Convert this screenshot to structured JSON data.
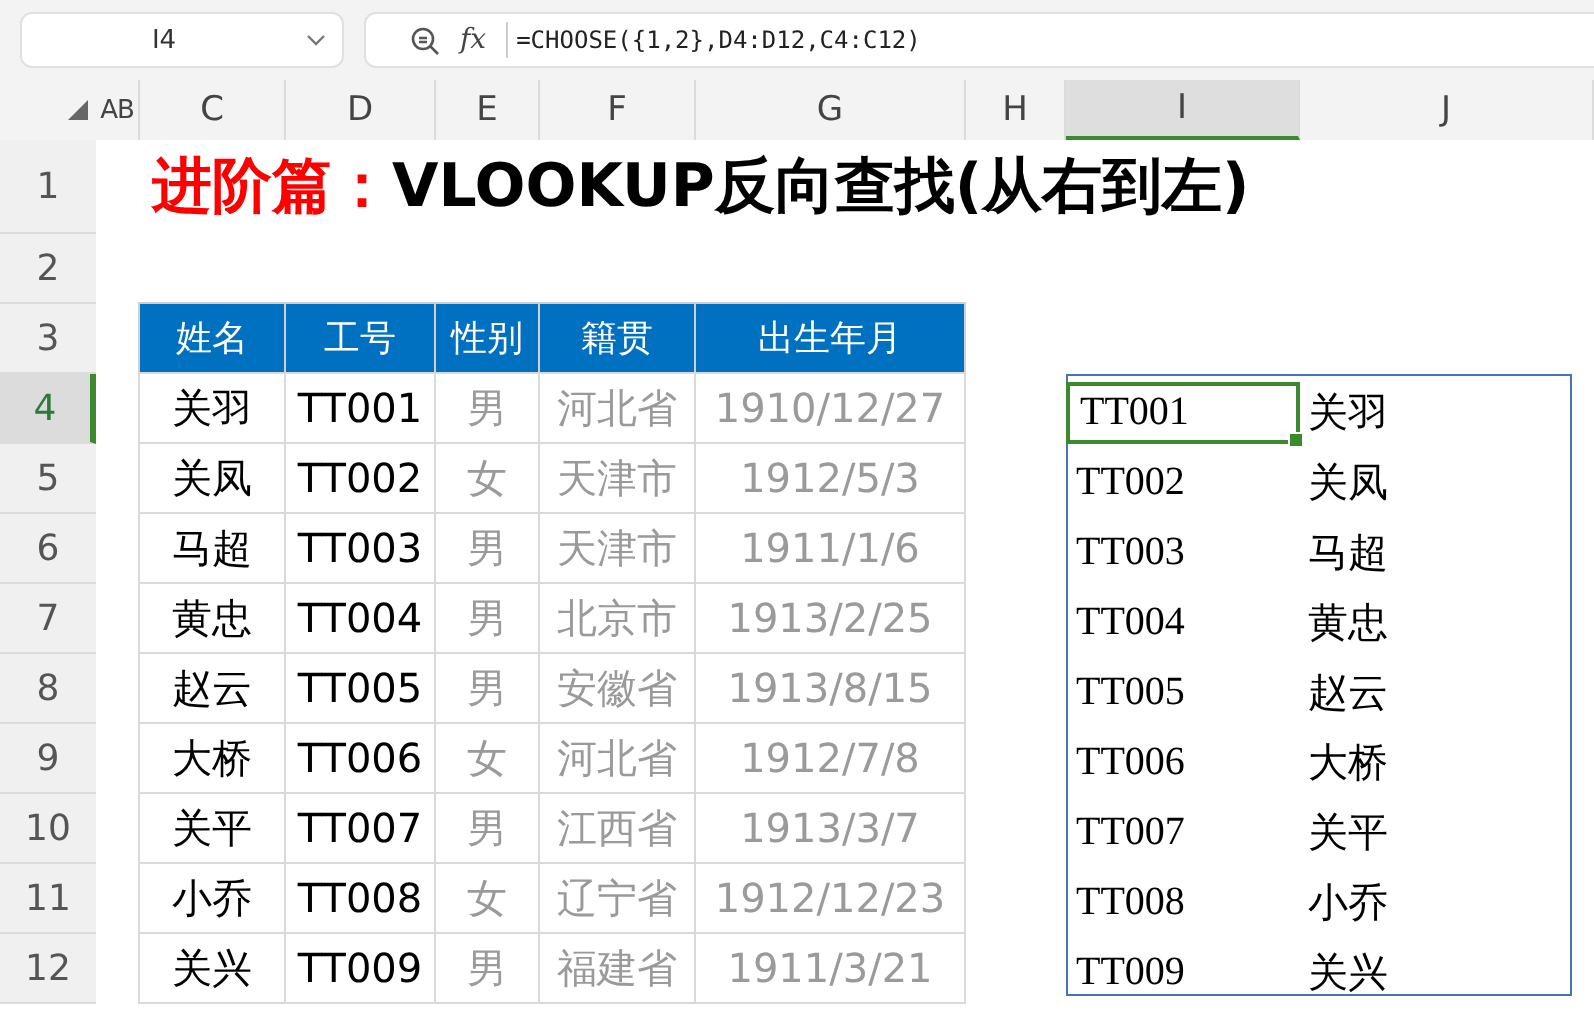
{
  "name_box": {
    "value": "I4"
  },
  "formula_bar": {
    "function_label": "fx",
    "formula": "=CHOOSE({1,2},D4:D12,C4:C12)"
  },
  "column_headers": [
    {
      "label": "AB",
      "selected": false
    },
    {
      "label": "C",
      "selected": false
    },
    {
      "label": "D",
      "selected": false
    },
    {
      "label": "E",
      "selected": false
    },
    {
      "label": "F",
      "selected": false
    },
    {
      "label": "G",
      "selected": false
    },
    {
      "label": "H",
      "selected": false
    },
    {
      "label": "I",
      "selected": true
    },
    {
      "label": "J",
      "selected": false
    }
  ],
  "row_headers": [
    {
      "label": "1",
      "selected": false
    },
    {
      "label": "2",
      "selected": false
    },
    {
      "label": "3",
      "selected": false
    },
    {
      "label": "4",
      "selected": true
    },
    {
      "label": "5",
      "selected": false
    },
    {
      "label": "6",
      "selected": false
    },
    {
      "label": "7",
      "selected": false
    },
    {
      "label": "8",
      "selected": false
    },
    {
      "label": "9",
      "selected": false
    },
    {
      "label": "10",
      "selected": false
    },
    {
      "label": "11",
      "selected": false
    },
    {
      "label": "12",
      "selected": false
    }
  ],
  "title_parts": [
    {
      "text": "进阶篇：",
      "color": "#ff0000"
    },
    {
      "text": "VLOOKUP反向查找(从右到左)",
      "color": "#000000"
    }
  ],
  "source_table": {
    "columns": [
      {
        "label": "姓名",
        "dimmed": false
      },
      {
        "label": "工号",
        "dimmed": false
      },
      {
        "label": "性别",
        "dimmed": true
      },
      {
        "label": "籍贯",
        "dimmed": true
      },
      {
        "label": "出生年月",
        "dimmed": true
      }
    ],
    "rows": [
      [
        "关羽",
        "TT001",
        "男",
        "河北省",
        "1910/12/27"
      ],
      [
        "关凤",
        "TT002",
        "女",
        "天津市",
        "1912/5/3"
      ],
      [
        "马超",
        "TT003",
        "男",
        "天津市",
        "1911/1/6"
      ],
      [
        "黄忠",
        "TT004",
        "男",
        "北京市",
        "1913/2/25"
      ],
      [
        "赵云",
        "TT005",
        "男",
        "安徽省",
        "1913/8/15"
      ],
      [
        "大桥",
        "TT006",
        "女",
        "河北省",
        "1912/7/8"
      ],
      [
        "关平",
        "TT007",
        "男",
        "江西省",
        "1913/3/7"
      ],
      [
        "小乔",
        "TT008",
        "女",
        "辽宁省",
        "1912/12/23"
      ],
      [
        "关兴",
        "TT009",
        "男",
        "福建省",
        "1911/3/21"
      ]
    ]
  },
  "result": {
    "rows": [
      {
        "cells": [
          {
            "text": "TT001",
            "selected": true
          },
          {
            "text": "关羽",
            "selected": false
          }
        ]
      },
      {
        "cells": [
          {
            "text": "TT002",
            "selected": false
          },
          {
            "text": "关凤",
            "selected": false
          }
        ]
      },
      {
        "cells": [
          {
            "text": "TT003",
            "selected": false
          },
          {
            "text": "马超",
            "selected": false
          }
        ]
      },
      {
        "cells": [
          {
            "text": "TT004",
            "selected": false
          },
          {
            "text": "黄忠",
            "selected": false
          }
        ]
      },
      {
        "cells": [
          {
            "text": "TT005",
            "selected": false
          },
          {
            "text": "赵云",
            "selected": false
          }
        ]
      },
      {
        "cells": [
          {
            "text": "TT006",
            "selected": false
          },
          {
            "text": "大桥",
            "selected": false
          }
        ]
      },
      {
        "cells": [
          {
            "text": "TT007",
            "selected": false
          },
          {
            "text": "关平",
            "selected": false
          }
        ]
      },
      {
        "cells": [
          {
            "text": "TT008",
            "selected": false
          },
          {
            "text": "小乔",
            "selected": false
          }
        ]
      },
      {
        "cells": [
          {
            "text": "TT009",
            "selected": false
          },
          {
            "text": "关兴",
            "selected": false
          }
        ]
      }
    ]
  }
}
